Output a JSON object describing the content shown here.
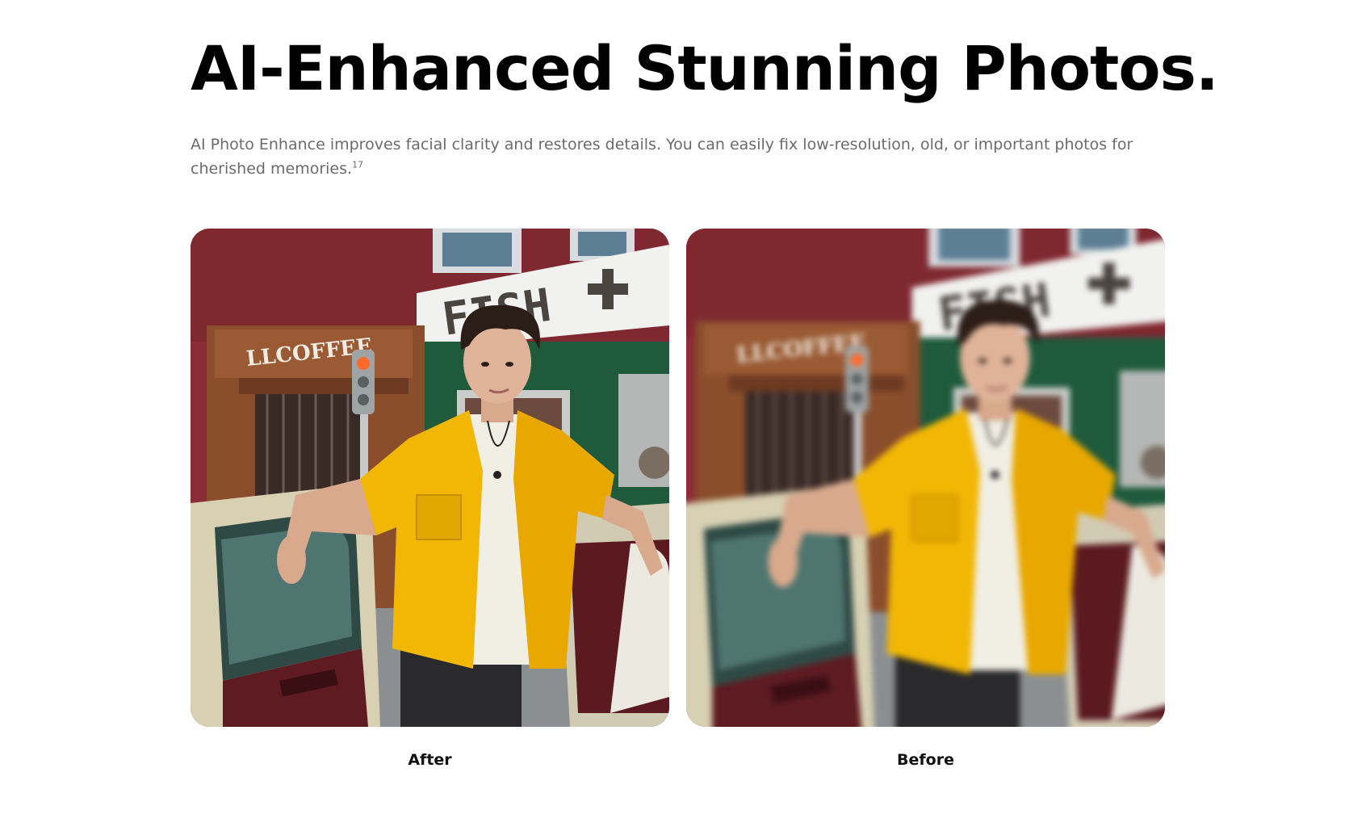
{
  "section": {
    "headline": "AI-Enhanced Stunning Photos.",
    "description": "AI Photo Enhance improves facial clarity and restores details. You can easily fix low-resolution, old, or important photos for cherished memories.",
    "footnote": "17"
  },
  "comparison": {
    "after_label": "After",
    "before_label": "Before",
    "sign_coffee": "LLCOFFEE",
    "sign_fish": "FISH"
  },
  "colors": {
    "headline": "#000000",
    "body_text": "#6b6b6b",
    "caption": "#111111",
    "shirt": "#f2b705"
  }
}
